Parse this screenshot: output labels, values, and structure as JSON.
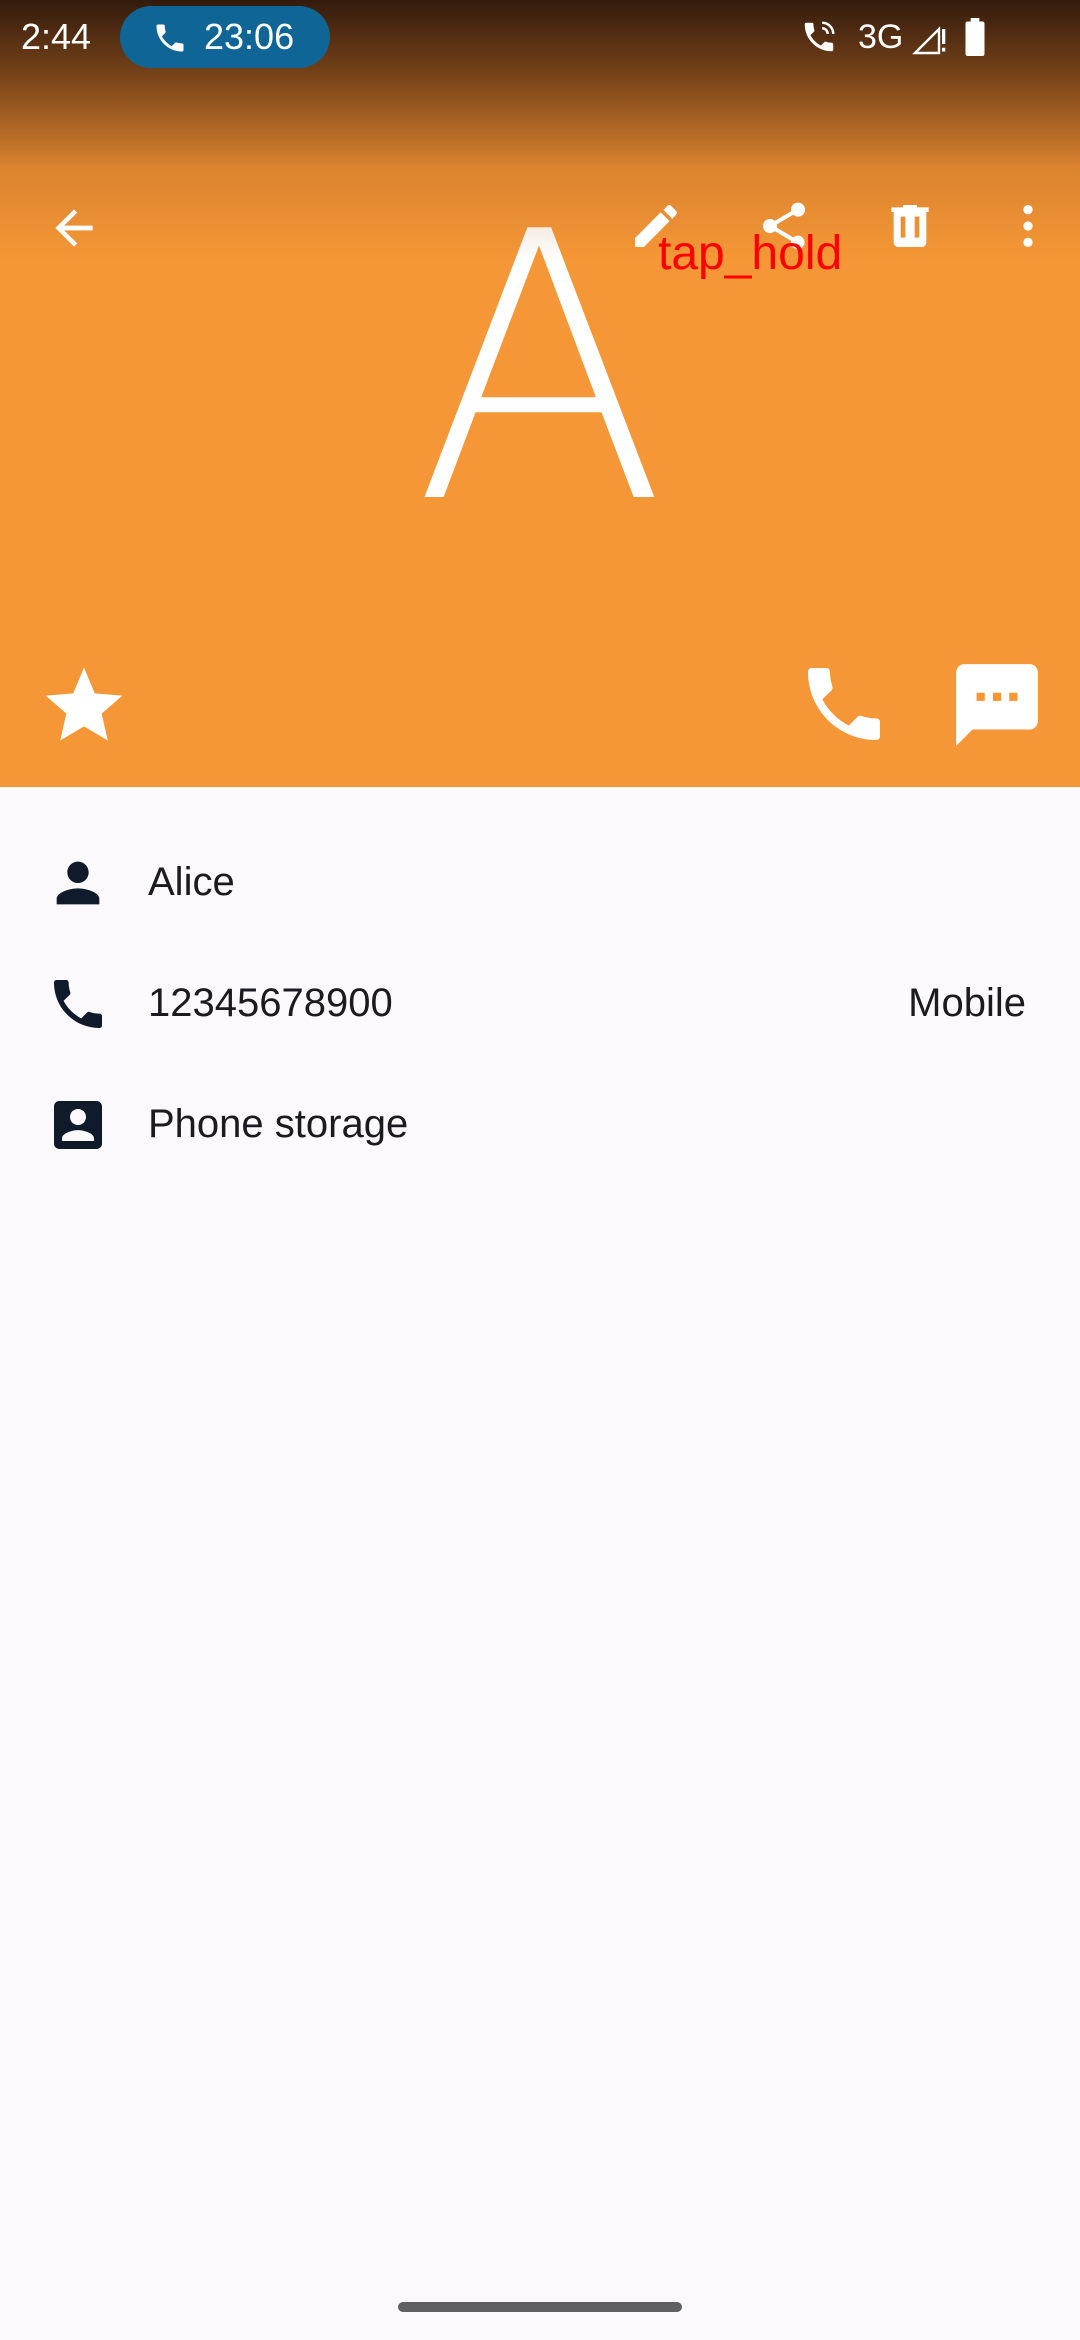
{
  "status_bar": {
    "time": "2:44",
    "call_chip_duration": "23:06",
    "network": "3G",
    "icons": [
      "phone-icon",
      "call-indicator-icon",
      "signal-icon",
      "battery-icon"
    ]
  },
  "toolbar": {
    "back_icon": "back-arrow-icon",
    "edit_icon": "edit-icon",
    "share_icon": "share-icon",
    "delete_icon": "delete-icon",
    "more_icon": "more-vert-icon"
  },
  "overlay_label": "tap_hold",
  "avatar": {
    "letter": "A",
    "background": "#f59736"
  },
  "header_actions": {
    "favorite_icon": "star-icon",
    "call_icon": "phone-icon",
    "message_icon": "message-icon"
  },
  "details": {
    "name": "Alice",
    "phone_number": "12345678900",
    "phone_type": "Mobile",
    "storage": "Phone storage"
  },
  "colors": {
    "header_orange": "#f59736",
    "call_chip": "#0f6696",
    "background": "#fbf9fc",
    "text": "#1b1b1f",
    "overlay_label": "#ff0000"
  }
}
